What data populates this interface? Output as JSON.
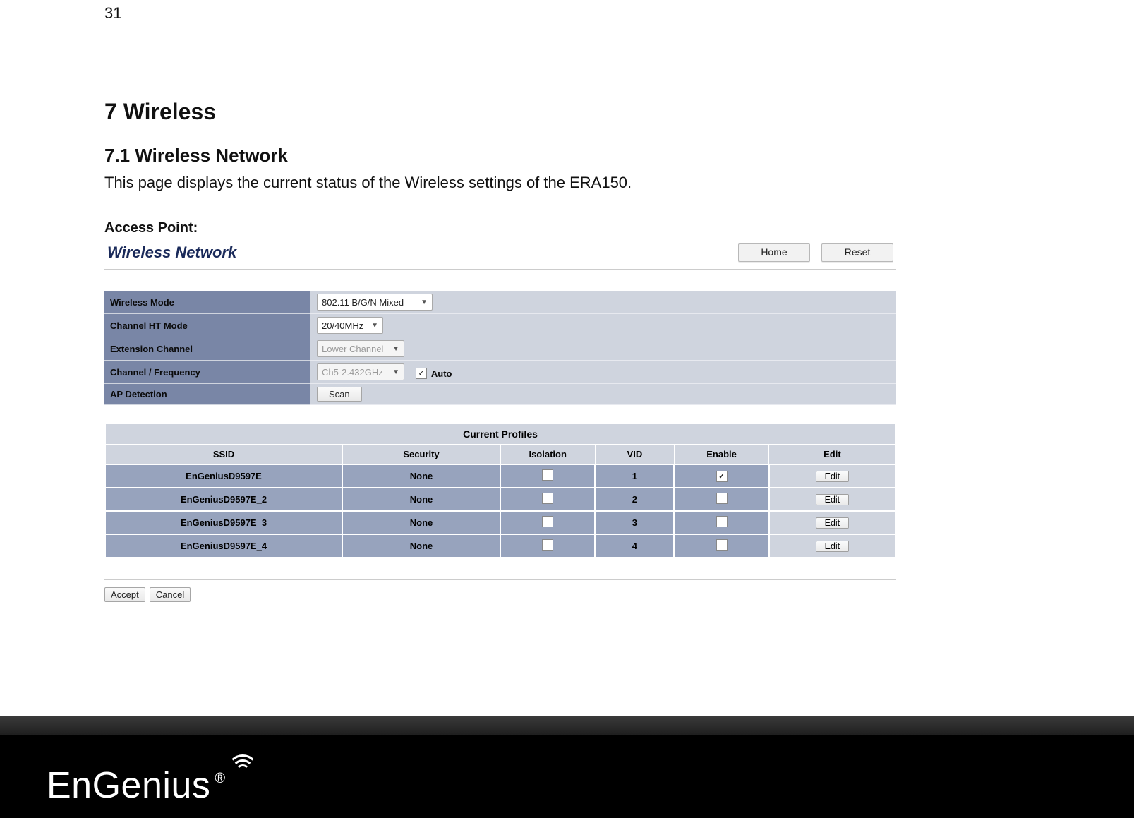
{
  "page_number": "31",
  "headings": {
    "h1": "7  Wireless",
    "h2": "7.1   Wireless Network"
  },
  "body_text": "This page displays the current status of the Wireless settings of the ERA150.",
  "access_point_label": "Access Point:",
  "panel": {
    "title": "Wireless Network",
    "top_buttons": {
      "home": "Home",
      "reset": "Reset"
    },
    "rows": {
      "wireless_mode": {
        "label": "Wireless Mode",
        "value": "802.11 B/G/N Mixed"
      },
      "channel_ht": {
        "label": "Channel HT Mode",
        "value": "20/40MHz"
      },
      "extension": {
        "label": "Extension Channel",
        "value": "Lower Channel"
      },
      "channel_freq": {
        "label": "Channel / Frequency",
        "value": "Ch5-2.432GHz",
        "auto_label": "Auto",
        "auto_checked": true
      },
      "ap_detection": {
        "label": "AP Detection",
        "scan_label": "Scan"
      }
    },
    "current_profiles_title": "Current Profiles",
    "profile_headers": {
      "ssid": "SSID",
      "security": "Security",
      "isolation": "Isolation",
      "vid": "VID",
      "enable": "Enable",
      "edit": "Edit"
    },
    "edit_button_label": "Edit",
    "profiles": [
      {
        "ssid": "EnGeniusD9597E",
        "security": "None",
        "vid": "1",
        "enable": true
      },
      {
        "ssid": "EnGeniusD9597E_2",
        "security": "None",
        "vid": "2",
        "enable": false
      },
      {
        "ssid": "EnGeniusD9597E_3",
        "security": "None",
        "vid": "3",
        "enable": false
      },
      {
        "ssid": "EnGeniusD9597E_4",
        "security": "None",
        "vid": "4",
        "enable": false
      }
    ],
    "bottom_buttons": {
      "accept": "Accept",
      "cancel": "Cancel"
    }
  },
  "brand": "EnGenius"
}
